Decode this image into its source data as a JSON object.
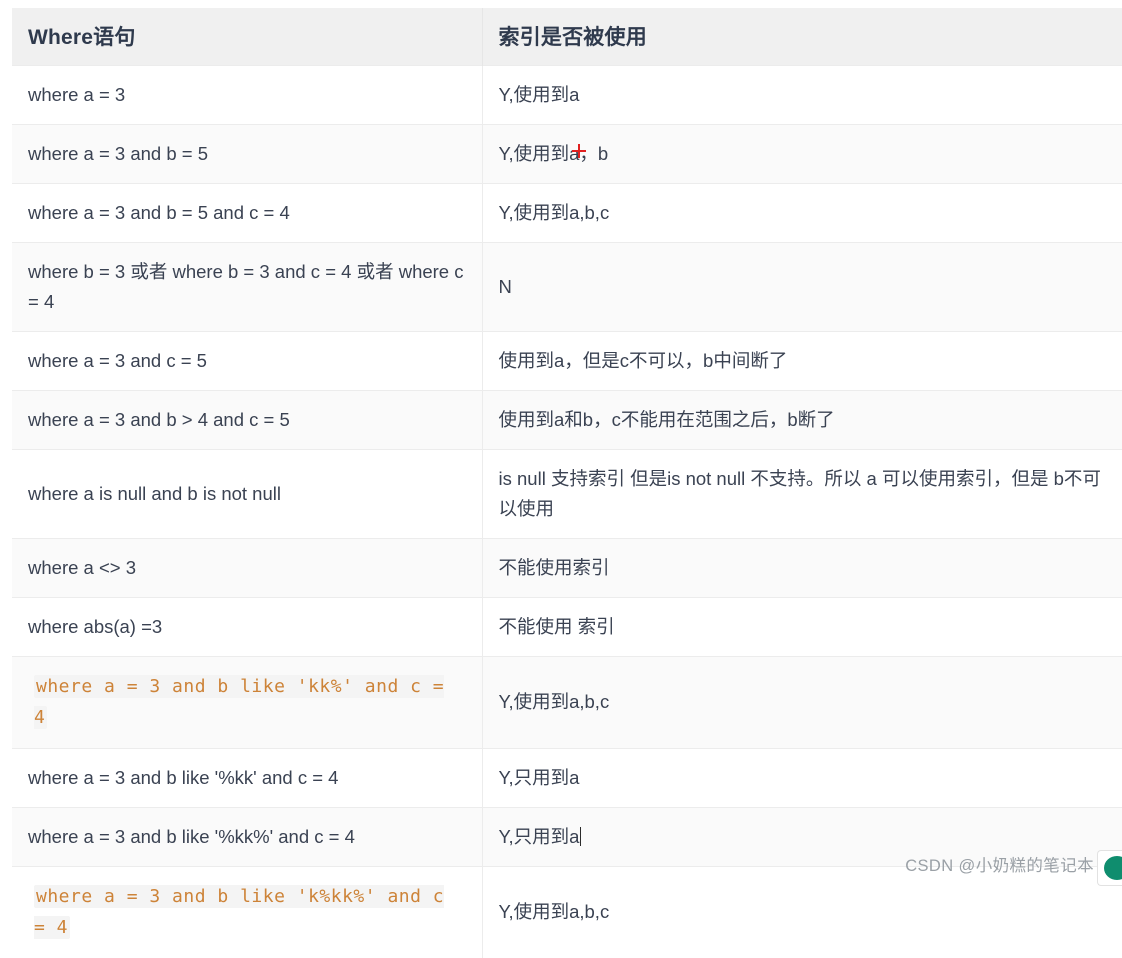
{
  "table": {
    "headers": {
      "where": "Where语句",
      "index": "索引是否被使用"
    },
    "rows": [
      {
        "where": "where a =  3",
        "index": "Y,使用到a",
        "code": false
      },
      {
        "where": "where a =  3 and b = 5",
        "index": "Y,使用到a，b",
        "code": false
      },
      {
        "where": "where a =  3 and b = 5 and c = 4",
        "index": "Y,使用到a,b,c",
        "code": false
      },
      {
        "where": "where b =  3 或者 where b = 3 and c =  4 或者 where c =  4",
        "index": "N",
        "code": false
      },
      {
        "where": "where a =  3 and c = 5",
        "index": "使用到a，但是c不可以，b中间断了",
        "code": false
      },
      {
        "where": "where a =  3 and b > 4 and c = 5",
        "index": "使用到a和b，c不能用在范围之后，b断了",
        "code": false
      },
      {
        "where": "where a is  null and b is not null",
        "index": "is null 支持索引 但是is not null 不支持。所以 a 可以使用索引，但是 b不可以使用",
        "code": false
      },
      {
        "where": "where a  <> 3",
        "index": "不能使用索引",
        "code": false
      },
      {
        "where": "where  abs(a) =3",
        "index": "不能使用 索引",
        "code": false
      },
      {
        "where": "where a =  3 and b like 'kk%' and c = 4",
        "index": "Y,使用到a,b,c",
        "code": true
      },
      {
        "where": "where a =  3 and b like '%kk' and c = 4",
        "index": "Y,只用到a",
        "code": false
      },
      {
        "where": "where a =  3 and b like '%kk%' and c = 4",
        "index": "Y,只用到a",
        "code": false,
        "caret": true
      },
      {
        "where": "where a =  3 and b like 'k%kk%' and c =  4",
        "index": "Y,使用到a,b,c",
        "code": true
      }
    ]
  },
  "watermark": {
    "text": "CSDN @小奶糕的笔记本"
  },
  "colors": {
    "header_bg": "#f0f0f0",
    "header_text": "#2f3a4d",
    "body_text": "#3a4252",
    "row_alt_bg": "#fafafa",
    "code_text": "#cd8338",
    "code_bg": "#f4f4f4",
    "border": "#ececec",
    "marker_red": "#e02020",
    "watermark_text": "#9aa0a6",
    "badge_green": "#0f8d6e"
  }
}
